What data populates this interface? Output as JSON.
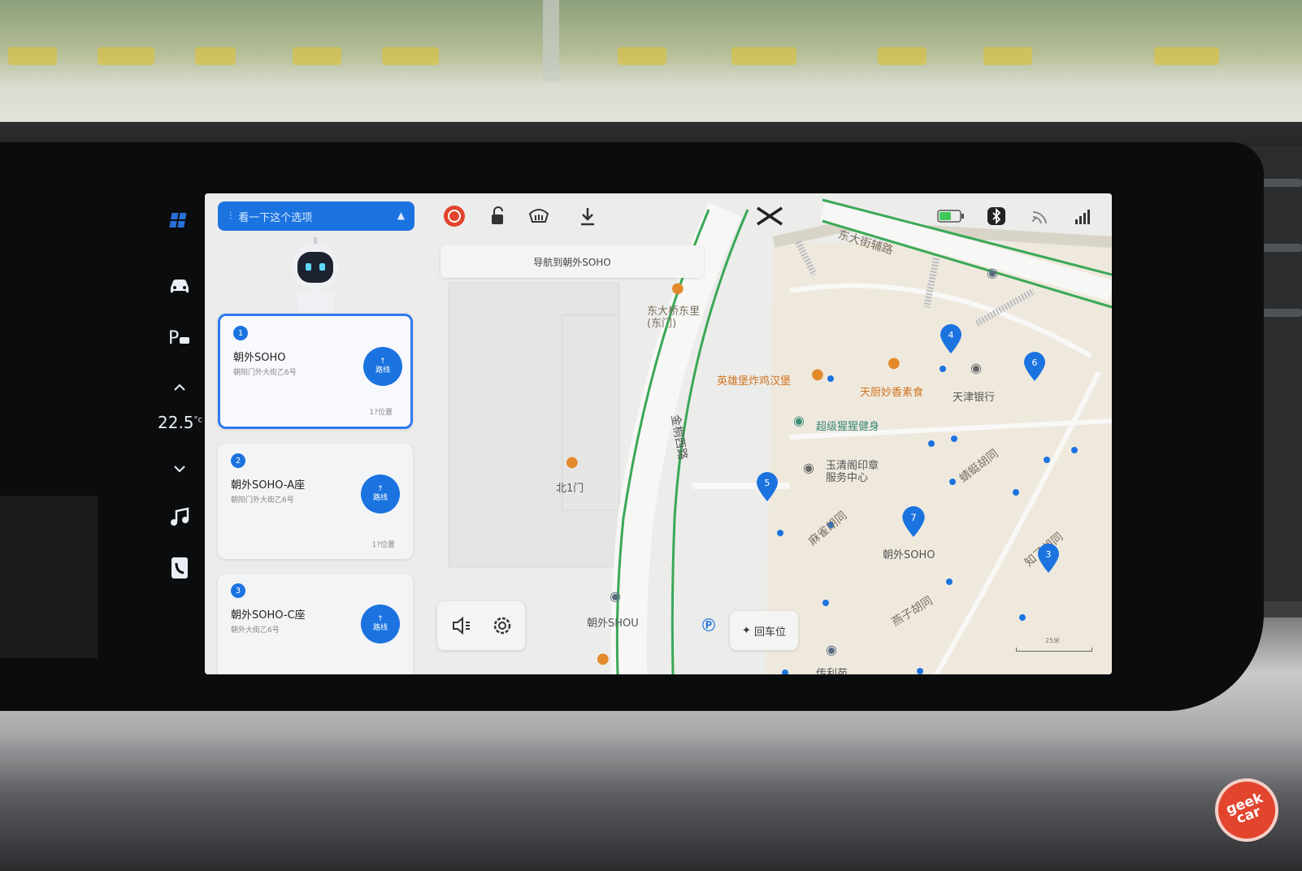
{
  "voice_assistant": {
    "prompt": "看一下这个选项"
  },
  "nav_banner": {
    "text": "导航到朝外SOHO"
  },
  "dock": {
    "temperature": "22.5",
    "temperature_unit": "°c"
  },
  "results": [
    {
      "index": "1",
      "title": "朝外SOHO",
      "address": "朝阳门外大街乙6号",
      "route_label": "路线",
      "count": "1?位置"
    },
    {
      "index": "2",
      "title": "朝外SOHO-A座",
      "address": "朝阳门外大街乙6号",
      "route_label": "路线",
      "count": "1?位置"
    },
    {
      "index": "3",
      "title": "朝外SOHO-C座",
      "address": "朝外大街乙6号",
      "route_label": "路线"
    }
  ],
  "map_tools": {
    "return_parking": "回车位"
  },
  "map": {
    "poi_labels": {
      "dongdaqiao": "东大桥东里\n(东门)",
      "beiyimen": "北1门",
      "burger": "英雄堡炸鸡汉堡",
      "tianchu": "天厨妙香素食",
      "tianjin_bank": "天津银行",
      "fitness": "超级猩猩健身",
      "yuqingge": "玉清阁印章\n服务中心",
      "chaowai_soho": "朝外SOHO",
      "chaowai_shou": "朝外SHOU",
      "bottom": "传利苑"
    },
    "road_labels": {
      "dongdajie": "东大街辅路",
      "jintong": "金桐西路",
      "maque": "麻雀胡同",
      "yanzi": "燕子胡同",
      "jingting": "蜻蜓胡同",
      "zhiliao": "知了胡同"
    },
    "pins": [
      "4",
      "6",
      "5",
      "7",
      "3"
    ],
    "scale": "25米"
  },
  "watermark": "geek car",
  "colors": {
    "accent": "#1b73e0",
    "route_green": "#3aa857",
    "map_bg": "#ececea",
    "poi_orange": "#e38a2c"
  }
}
